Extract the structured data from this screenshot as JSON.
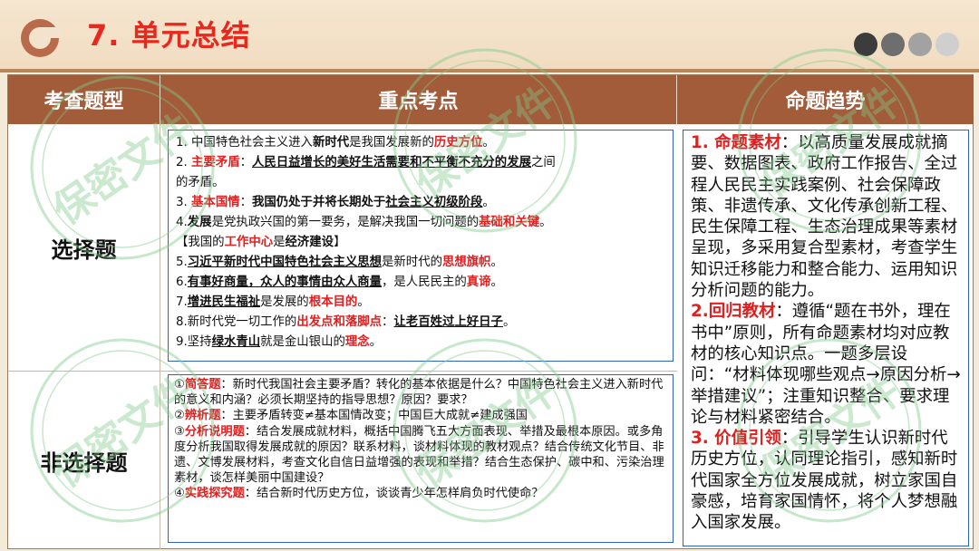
{
  "header": {
    "title": "7. 单元总结",
    "dot_colors": [
      "#3c3c3c",
      "#6e6e6e",
      "#a2a2a2",
      "#cfcfcf"
    ]
  },
  "watermark": {
    "text": "保密文件"
  },
  "table": {
    "headers": [
      "考查题型",
      "重点考点",
      "命题趋势"
    ],
    "row1_label": "选择题",
    "row2_label": "非选择题",
    "key_points": {
      "l1": [
        "1. 中国特色社会主义进入",
        "新时代",
        "是我国发展新的",
        "历史方位",
        "。"
      ],
      "l2": [
        "2. ",
        "主要矛盾",
        "：",
        "人民日益增长的美好生活需要和不平衡不充分的发展",
        "之间"
      ],
      "l2b": "的矛盾。",
      "l3": [
        "3. ",
        "基本国情",
        "：",
        "我国仍处于并将长期处于",
        "社会主义初级阶段",
        "。"
      ],
      "l4": [
        "4.",
        "发展",
        "是党执政兴国的第一要务，是解决我国一切问题的",
        "基础和关键",
        "。"
      ],
      "l5": [
        "【我国的",
        "工作中心",
        "是",
        "经济建设",
        "】"
      ],
      "l6": [
        "5.",
        "习近平新时代中国特色社会主义思想",
        "是新时代的",
        "思想旗帜",
        "。"
      ],
      "l7": [
        "6.",
        "有事好商量，众人的事情由众人商量",
        "，是人民民主的",
        "真谛",
        "。"
      ],
      "l8": [
        "7.",
        "增进民生福祉",
        "是发展的",
        "根本目的",
        "。"
      ],
      "l9": [
        "8.新时代党一切工作的",
        "出发点和落脚点",
        "：",
        "让老百姓过上好日子",
        "。"
      ],
      "l10": [
        "9.坚持",
        "绿水青山",
        "就是金山银山的",
        "理念",
        "。"
      ]
    },
    "non_choice": {
      "q1_num": "①",
      "q1_label": "简答题",
      "q1_text": "：新时代我国社会主要矛盾？转化的基本依据是什么？中国特色社会主义进入新时代的意义和内涵？必须长期坚持的指导思想？原因？要求？",
      "q2_num": "②",
      "q2_label": "辨析题",
      "q2_text": "：主要矛盾转变≠基本国情改变；中国巨大成就≠建成强国",
      "q3_num": "③",
      "q3_label": "分析说明题",
      "q3_text": "：结合发展成就材料，概括中国腾飞五大方面表现、举措及最根本原因。或多角度分析我国取得发展成就的原因？联系材料，谈材料体现的教材观点？结合传统文化节目、非遗、文博发展材料，考查文化自信日益增强的表现和举措？结合生态保护、碳中和、污染治理素材，谈怎样美丽中国建设？",
      "q4_num": "④",
      "q4_label": "实践探究题",
      "q4_text": "：结合新时代历史方位，谈谈青少年怎样肩负时代使命？"
    },
    "trend": {
      "t1_label": "1. 命题素材",
      "t1_text": "：以高质量发展成就摘要、数据图表、政府工作报告、全过程人民民主实践案例、社会保障政策、非遗传承、文化传承创新工程、民生保障工程、生态治理成果等素材呈现，多采用复合型素材，考查学生知识迁移能力和整合能力、运用知识分析问题的能力。",
      "t2_label": "2.回归教材",
      "t2_text": "：遵循“题在书外，理在书中”原则，所有命题素材均对应教材的核心知识点。一题多层设问：“材料体现哪些观点→原因分析→举措建议”；注重知识整合、要求理论与材料紧密结合。",
      "t3_label": "3. 价值引领",
      "t3_text": "：引导学生认识新时代历史方位，认同理论指引，感知新时代国家全方位发展成就，树立家国自豪感，培育家国情怀，将个人梦想融入国家发展。"
    }
  }
}
